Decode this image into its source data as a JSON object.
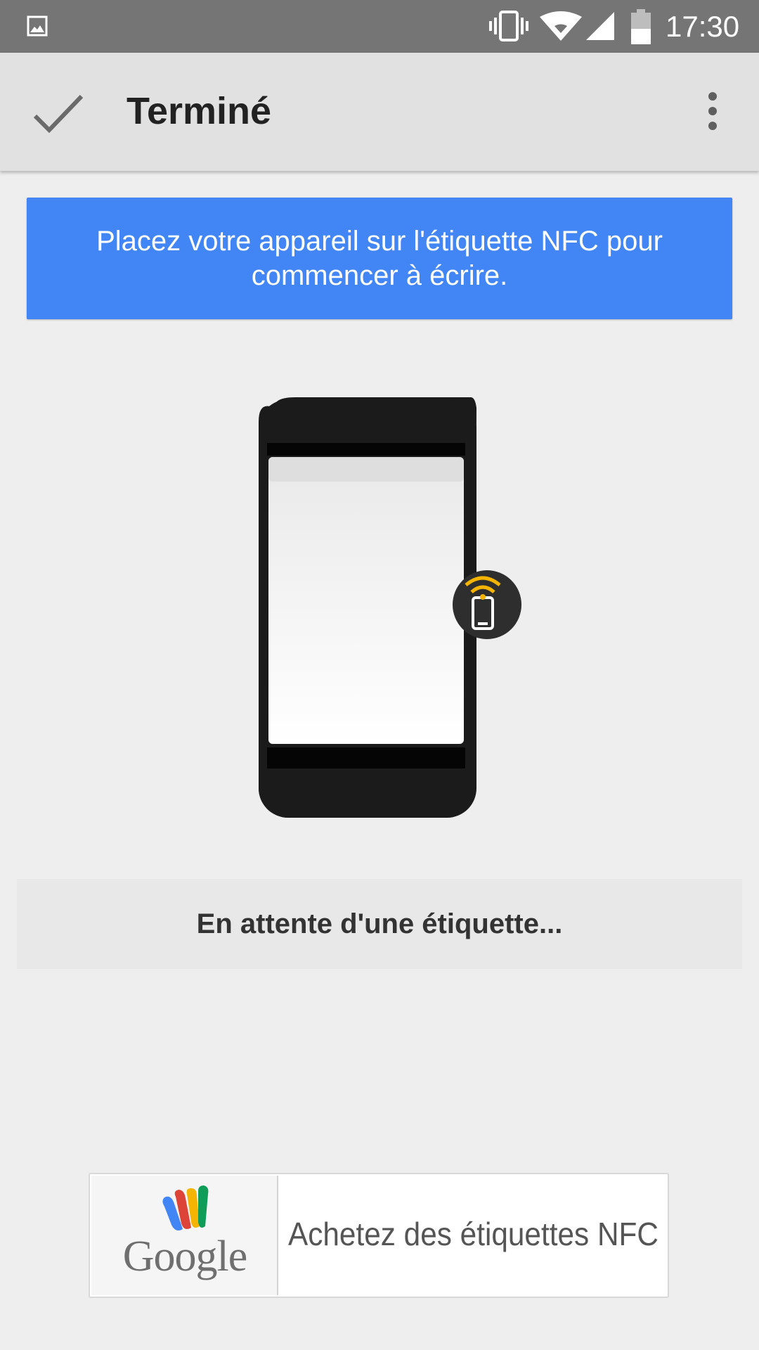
{
  "status_bar": {
    "time": "17:30",
    "icons": [
      "gallery-icon",
      "vibrate-icon",
      "wifi-icon",
      "signal-icon",
      "battery-icon"
    ]
  },
  "action_bar": {
    "done_icon": "check-icon",
    "title": "Terminé",
    "overflow_icon": "more-vert-icon"
  },
  "banner": {
    "text": "Placez votre appareil sur l'étiquette NFC pour commencer à écrire.",
    "color": "#4285f4"
  },
  "illustration": {
    "icon": "nfc-phone-icon",
    "accent_color": "#f4b400"
  },
  "status": {
    "waiting_text": "En attente d'une étiquette..."
  },
  "buy_button": {
    "brand": "Google",
    "brand_icon": "google-wallet-icon",
    "label": "Achetez des étiquettes NFC"
  }
}
